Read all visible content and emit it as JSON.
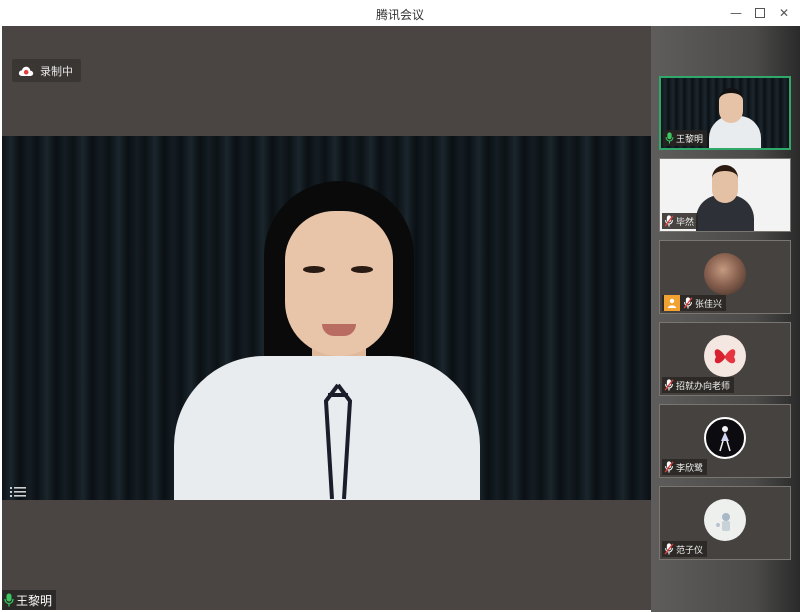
{
  "window": {
    "title": "腾讯会议"
  },
  "recording": {
    "label": "录制中"
  },
  "main_speaker": {
    "name": "王黎明"
  },
  "participants": [
    {
      "name": "王黎明",
      "mic": "on"
    },
    {
      "name": "毕然",
      "mic": "muted"
    },
    {
      "name": "张佳兴",
      "mic": "muted"
    },
    {
      "name": "招就办向老师",
      "mic": "muted"
    },
    {
      "name": "李欣鹭",
      "mic": "muted"
    },
    {
      "name": "范子仪",
      "mic": "muted"
    }
  ],
  "colors": {
    "active_border": "#2fa86a",
    "mic_on": "#3cc860",
    "mic_muted": "#e23c3c",
    "recording_icon": "#e23c3c"
  }
}
